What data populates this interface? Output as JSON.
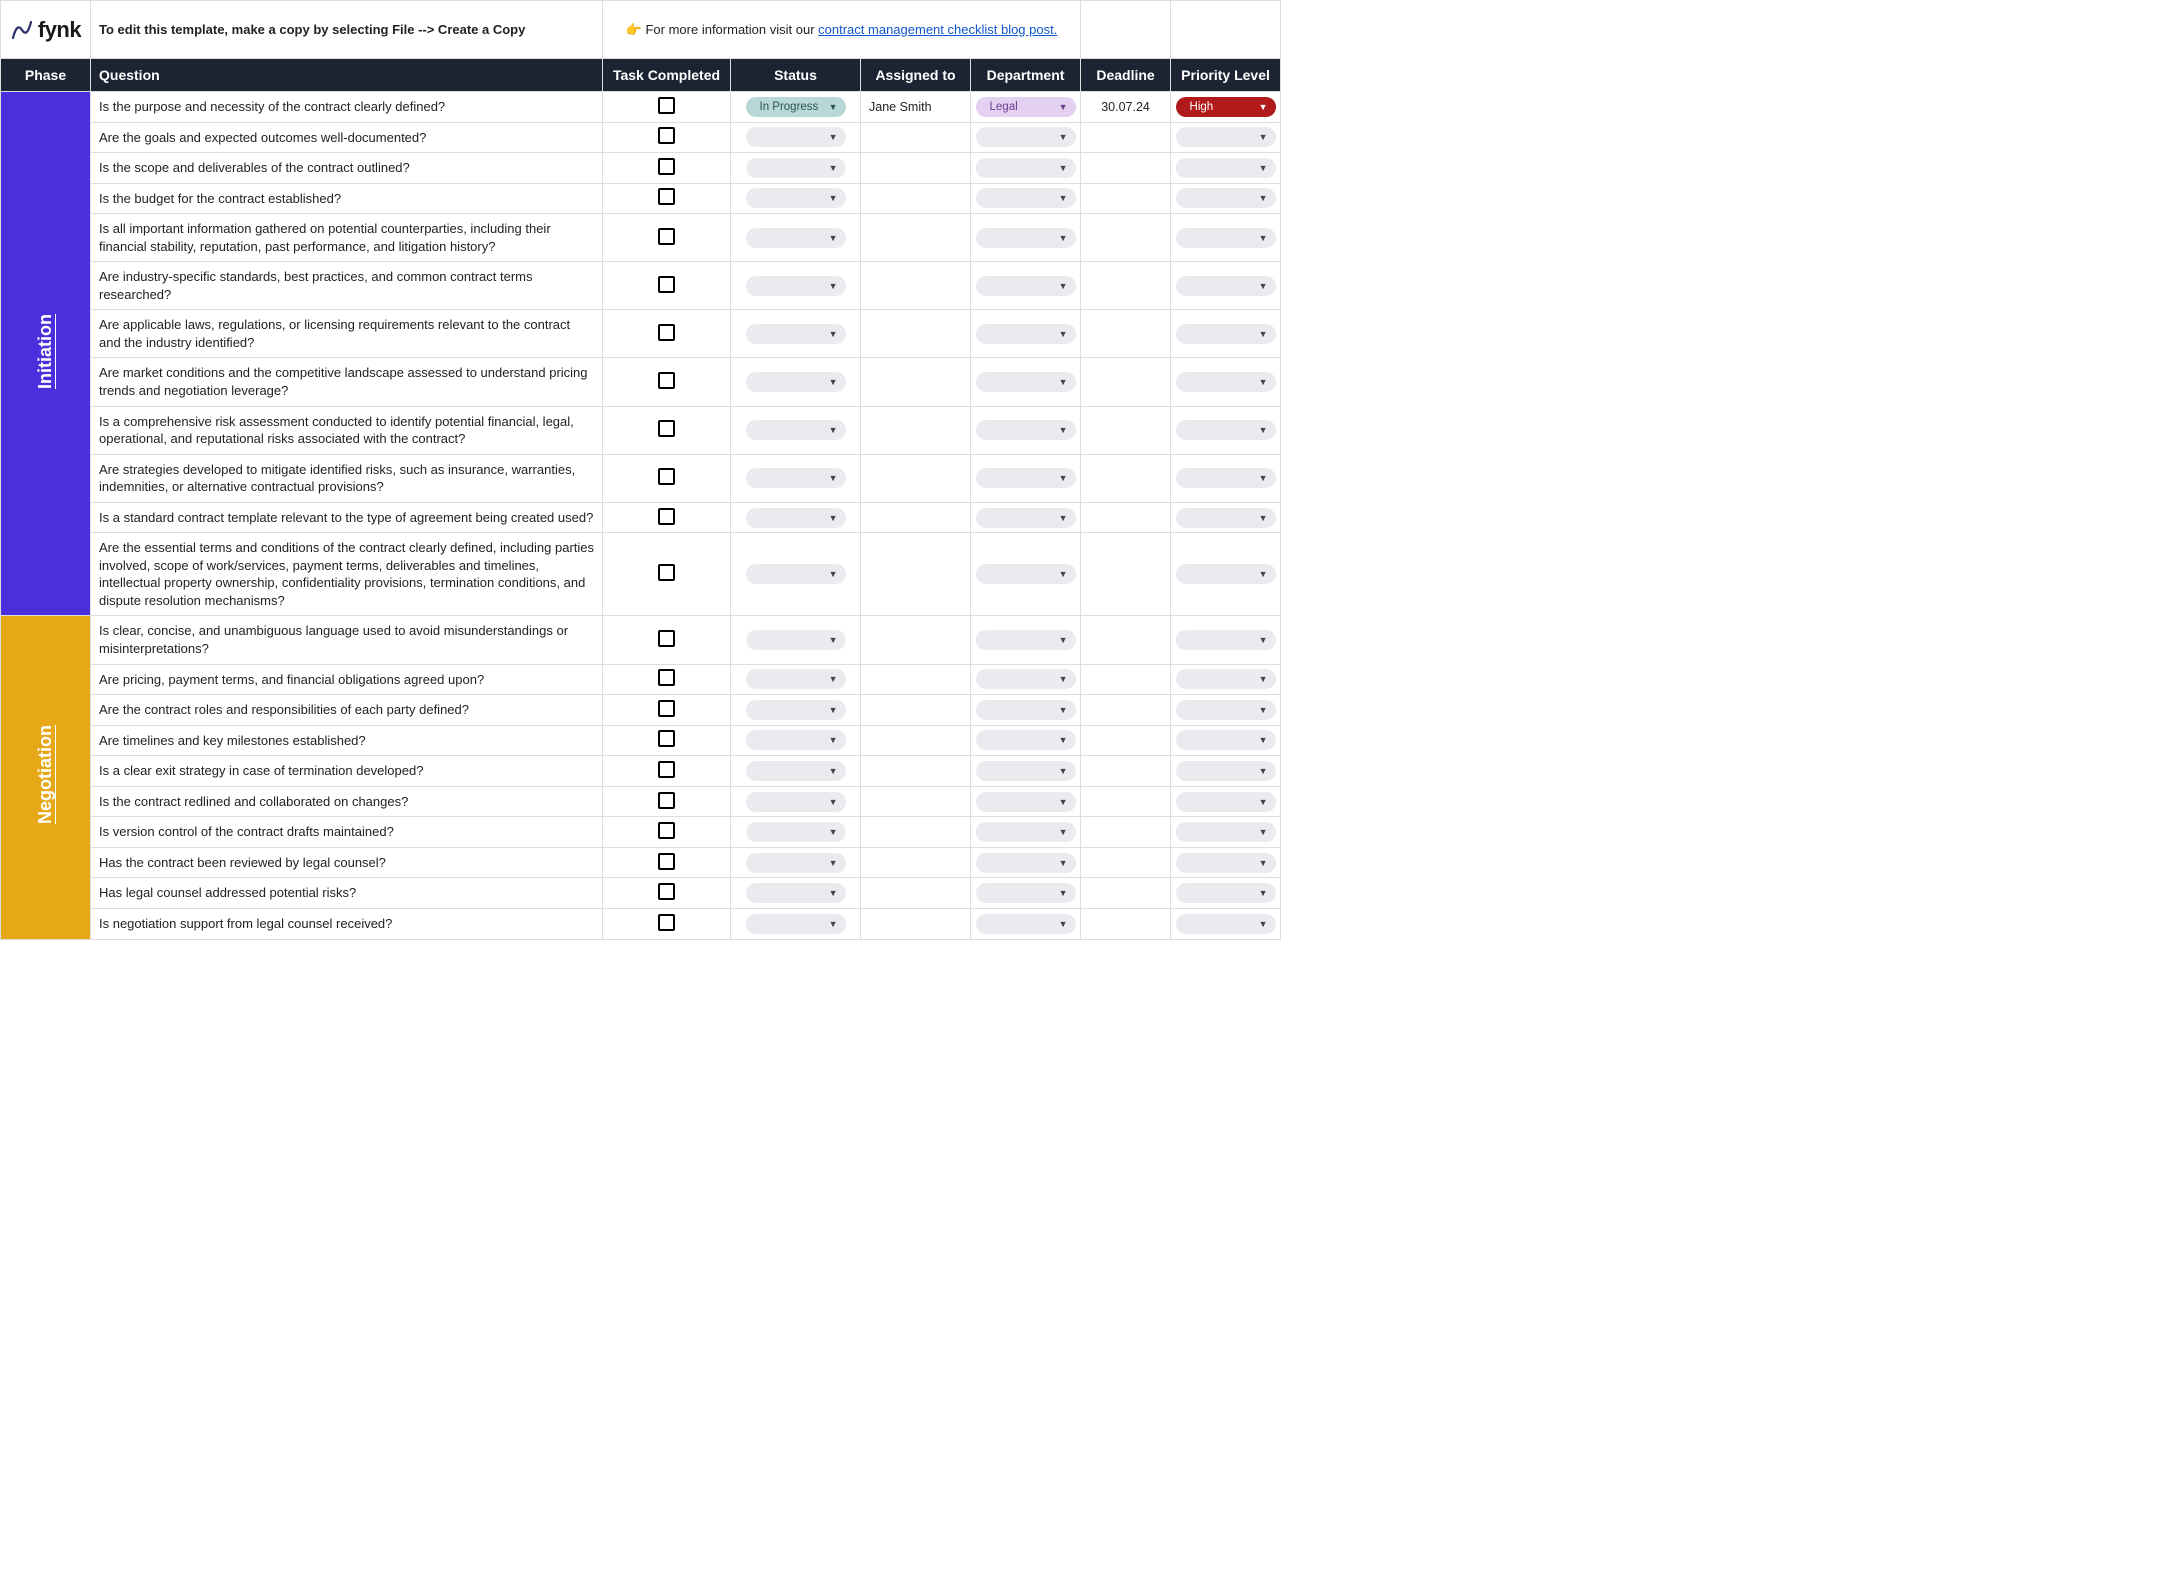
{
  "brand": {
    "name": "fynk"
  },
  "topRow": {
    "instructions": "To edit this template, make a copy by selecting File --> Create a Copy",
    "infoPrefix": "👉  For more information visit our ",
    "infoLinkText": "contract management checklist blog post.",
    "infoSuffix": ""
  },
  "headers": {
    "phase": "Phase",
    "question": "Question",
    "task": "Task Completed",
    "status": "Status",
    "assigned": "Assigned to",
    "department": "Department",
    "deadline": "Deadline",
    "priority": "Priority Level"
  },
  "phases": [
    {
      "id": "initiation",
      "label": "Initiation",
      "cssClass": "phase-initiation",
      "rows": [
        {
          "question": "Is the purpose and necessity of the contract clearly defined?",
          "status": "In Progress",
          "assigned": "Jane Smith",
          "department": "Legal",
          "deadline": "30.07.24",
          "priority": "High"
        },
        {
          "question": "Are the goals and expected outcomes well-documented?"
        },
        {
          "question": "Is the scope and deliverables of the contract outlined?"
        },
        {
          "question": "Is the budget for the contract established?"
        },
        {
          "question": "Is all important information gathered on potential counterparties, including their financial stability, reputation, past performance, and litigation history?"
        },
        {
          "question": "Are industry-specific standards, best practices, and common contract terms researched?"
        },
        {
          "question": "Are applicable laws, regulations, or licensing requirements relevant to the contract and the industry identified?"
        },
        {
          "question": "Are market conditions and the competitive landscape assessed to understand pricing trends and negotiation leverage?"
        },
        {
          "question": "Is a comprehensive risk assessment conducted to identify potential financial, legal, operational, and reputational risks associated with the contract?"
        },
        {
          "question": "Are strategies developed to mitigate identified risks, such as insurance, warranties, indemnities, or alternative contractual provisions?"
        },
        {
          "question": "Is a standard contract template relevant to the type of agreement being created used?"
        },
        {
          "question": "Are the essential terms and conditions of the contract clearly defined, including parties involved, scope of work/services, payment terms, deliverables and timelines, intellectual property ownership, confidentiality provisions, termination conditions, and dispute resolution mechanisms?"
        }
      ]
    },
    {
      "id": "negotiation",
      "label": "Negotiation",
      "cssClass": "phase-negotiation",
      "rows": [
        {
          "question": "Is clear, concise, and unambiguous language used to avoid misunderstandings or misinterpretations?"
        },
        {
          "question": "Are pricing, payment terms, and financial obligations agreed upon?"
        },
        {
          "question": "Are the contract roles and responsibilities of each party defined?"
        },
        {
          "question": "Are timelines and key milestones established?"
        },
        {
          "question": "Is a clear exit strategy in case of termination developed?"
        },
        {
          "question": "Is the contract redlined and collaborated on changes?"
        },
        {
          "question": "Is version control of the contract drafts maintained?"
        },
        {
          "question": "Has the contract been reviewed by legal counsel?"
        },
        {
          "question": "Has legal counsel addressed potential risks?"
        },
        {
          "question": "Is negotiation support from legal counsel received?"
        }
      ]
    }
  ]
}
